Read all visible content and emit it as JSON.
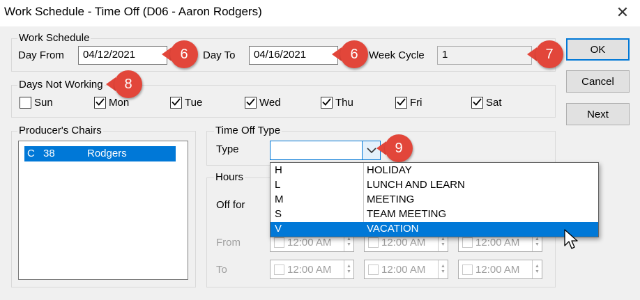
{
  "window": {
    "title": "Work Schedule - Time Off (D06 - Aaron Rodgers)",
    "close_glyph": "✕"
  },
  "work_schedule": {
    "legend": "Work Schedule",
    "day_from_label": "Day From",
    "day_from_value": "04/12/2021",
    "day_to_label": "Day To",
    "day_to_value": "04/16/2021",
    "week_cycle_label": "Week Cycle",
    "week_cycle_value": "1"
  },
  "buttons": {
    "ok": "OK",
    "cancel": "Cancel",
    "next": "Next"
  },
  "days_not_working": {
    "legend": "Days Not Working",
    "days": [
      {
        "label": "Sun",
        "checked": false
      },
      {
        "label": "Mon",
        "checked": true
      },
      {
        "label": "Tue",
        "checked": true
      },
      {
        "label": "Wed",
        "checked": true
      },
      {
        "label": "Thu",
        "checked": true
      },
      {
        "label": "Fri",
        "checked": true
      },
      {
        "label": "Sat",
        "checked": true
      }
    ]
  },
  "producers_chairs": {
    "legend": "Producer's Chairs",
    "items": [
      {
        "code": "C",
        "num": "38",
        "name": "Rodgers",
        "selected": true
      }
    ]
  },
  "time_off_type": {
    "legend": "Time Off Type",
    "type_label": "Type",
    "type_value": "",
    "options": [
      {
        "code": "H",
        "name": "HOLIDAY",
        "selected": false
      },
      {
        "code": "L",
        "name": "LUNCH AND LEARN",
        "selected": false
      },
      {
        "code": "M",
        "name": "MEETING",
        "selected": false
      },
      {
        "code": "S",
        "name": "TEAM MEETING",
        "selected": false
      },
      {
        "code": "V",
        "name": "VACATION",
        "selected": true
      }
    ]
  },
  "hours": {
    "legend": "Hours",
    "off_for_label": "Off for",
    "from_label": "From",
    "to_label": "To",
    "time_value": "12:00 AM"
  },
  "callouts": [
    "6",
    "6",
    "7",
    "8",
    "9"
  ],
  "colors": {
    "accent": "#0078d7",
    "callout": "#e2463a",
    "background": "#f0f0f0"
  }
}
